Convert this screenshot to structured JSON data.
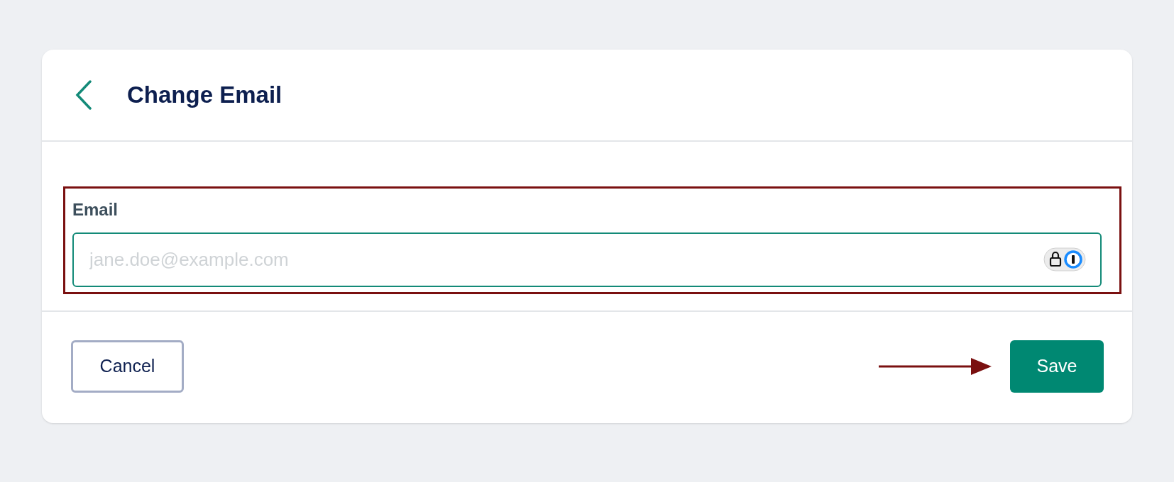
{
  "header": {
    "title": "Change Email"
  },
  "field": {
    "label": "Email",
    "placeholder": "jane.doe@example.com",
    "highlighted": true
  },
  "buttons": [
    {
      "label": "Cancel",
      "kind": "secondary"
    },
    {
      "label": "Save",
      "kind": "primary",
      "pointed": true
    }
  ]
}
